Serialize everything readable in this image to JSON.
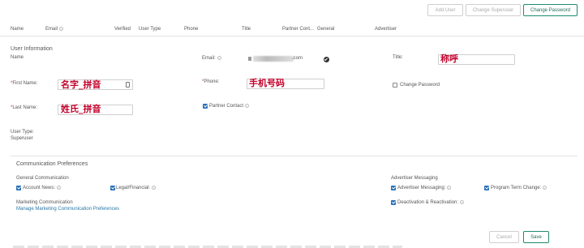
{
  "toolbar": {
    "add_user": "Add User",
    "change_superuser": "Change Superuser",
    "change_password": "Change Password"
  },
  "table": {
    "columns": [
      "Name",
      "Email",
      "Verified",
      "User Type",
      "Phone",
      "Title",
      "Partner Cont...",
      "General",
      "Advertiser"
    ]
  },
  "user_info": {
    "section_title": "User Information",
    "name_label": "Name",
    "email_label": "Email:",
    "email_value_suffix": ".com",
    "title_label": "Title:",
    "title_annotation": "称呼",
    "first_name_label": "First Name:",
    "first_name_annotation": "名字_拼音",
    "phone_label": "Phone:",
    "phone_annotation": "手机号码",
    "change_password_label": "Change Password",
    "last_name_label": "Last Name:",
    "last_name_annotation": "姓氏_拼音",
    "partner_contact_label": "Partner Contact",
    "user_type_label": "User Type:",
    "user_type_value": "Superuser"
  },
  "comm_prefs": {
    "section_title": "Communication Preferences",
    "general_title": "General Communication",
    "account_news": "Account News:",
    "legal_financial": "Legal/Financial:",
    "marketing_title": "Marketing Communication",
    "manage_marketing_link": "Manage Marketing Communication Preferences",
    "advertiser_title": "Advertiser Messaging",
    "advertiser_messaging": "Advertiser Messaging:",
    "program_term_change": "Program Term Change:",
    "deactivation_reactivation": "Deactivation & Reactivation:"
  },
  "footer": {
    "cancel": "Cancel",
    "save": "Save"
  },
  "colors": {
    "accent": "#1f8a70",
    "checkbox": "#2a6fb5",
    "annotation": "#c2002a",
    "link": "#2a78a6"
  }
}
